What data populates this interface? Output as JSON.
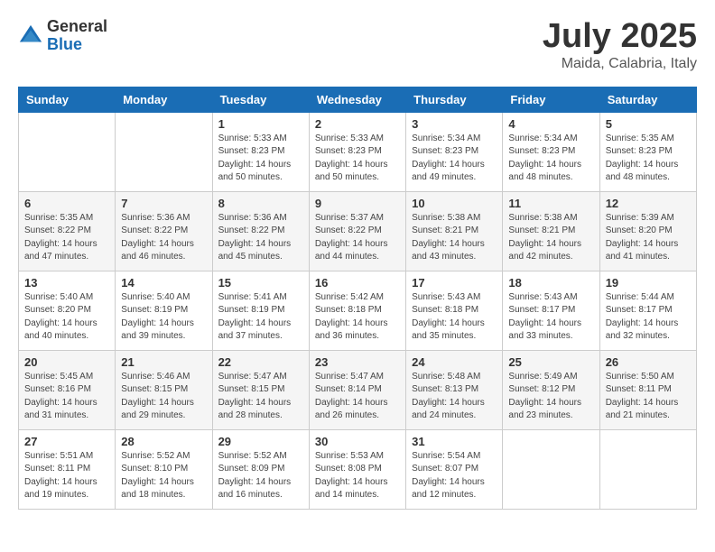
{
  "header": {
    "logo_general": "General",
    "logo_blue": "Blue",
    "month": "July 2025",
    "location": "Maida, Calabria, Italy"
  },
  "weekdays": [
    "Sunday",
    "Monday",
    "Tuesday",
    "Wednesday",
    "Thursday",
    "Friday",
    "Saturday"
  ],
  "weeks": [
    [
      {
        "day": "",
        "sunrise": "",
        "sunset": "",
        "daylight": ""
      },
      {
        "day": "",
        "sunrise": "",
        "sunset": "",
        "daylight": ""
      },
      {
        "day": "1",
        "sunrise": "5:33 AM",
        "sunset": "8:23 PM",
        "daylight": "14 hours and 50 minutes."
      },
      {
        "day": "2",
        "sunrise": "5:33 AM",
        "sunset": "8:23 PM",
        "daylight": "14 hours and 50 minutes."
      },
      {
        "day": "3",
        "sunrise": "5:34 AM",
        "sunset": "8:23 PM",
        "daylight": "14 hours and 49 minutes."
      },
      {
        "day": "4",
        "sunrise": "5:34 AM",
        "sunset": "8:23 PM",
        "daylight": "14 hours and 48 minutes."
      },
      {
        "day": "5",
        "sunrise": "5:35 AM",
        "sunset": "8:23 PM",
        "daylight": "14 hours and 48 minutes."
      }
    ],
    [
      {
        "day": "6",
        "sunrise": "5:35 AM",
        "sunset": "8:22 PM",
        "daylight": "14 hours and 47 minutes."
      },
      {
        "day": "7",
        "sunrise": "5:36 AM",
        "sunset": "8:22 PM",
        "daylight": "14 hours and 46 minutes."
      },
      {
        "day": "8",
        "sunrise": "5:36 AM",
        "sunset": "8:22 PM",
        "daylight": "14 hours and 45 minutes."
      },
      {
        "day": "9",
        "sunrise": "5:37 AM",
        "sunset": "8:22 PM",
        "daylight": "14 hours and 44 minutes."
      },
      {
        "day": "10",
        "sunrise": "5:38 AM",
        "sunset": "8:21 PM",
        "daylight": "14 hours and 43 minutes."
      },
      {
        "day": "11",
        "sunrise": "5:38 AM",
        "sunset": "8:21 PM",
        "daylight": "14 hours and 42 minutes."
      },
      {
        "day": "12",
        "sunrise": "5:39 AM",
        "sunset": "8:20 PM",
        "daylight": "14 hours and 41 minutes."
      }
    ],
    [
      {
        "day": "13",
        "sunrise": "5:40 AM",
        "sunset": "8:20 PM",
        "daylight": "14 hours and 40 minutes."
      },
      {
        "day": "14",
        "sunrise": "5:40 AM",
        "sunset": "8:19 PM",
        "daylight": "14 hours and 39 minutes."
      },
      {
        "day": "15",
        "sunrise": "5:41 AM",
        "sunset": "8:19 PM",
        "daylight": "14 hours and 37 minutes."
      },
      {
        "day": "16",
        "sunrise": "5:42 AM",
        "sunset": "8:18 PM",
        "daylight": "14 hours and 36 minutes."
      },
      {
        "day": "17",
        "sunrise": "5:43 AM",
        "sunset": "8:18 PM",
        "daylight": "14 hours and 35 minutes."
      },
      {
        "day": "18",
        "sunrise": "5:43 AM",
        "sunset": "8:17 PM",
        "daylight": "14 hours and 33 minutes."
      },
      {
        "day": "19",
        "sunrise": "5:44 AM",
        "sunset": "8:17 PM",
        "daylight": "14 hours and 32 minutes."
      }
    ],
    [
      {
        "day": "20",
        "sunrise": "5:45 AM",
        "sunset": "8:16 PM",
        "daylight": "14 hours and 31 minutes."
      },
      {
        "day": "21",
        "sunrise": "5:46 AM",
        "sunset": "8:15 PM",
        "daylight": "14 hours and 29 minutes."
      },
      {
        "day": "22",
        "sunrise": "5:47 AM",
        "sunset": "8:15 PM",
        "daylight": "14 hours and 28 minutes."
      },
      {
        "day": "23",
        "sunrise": "5:47 AM",
        "sunset": "8:14 PM",
        "daylight": "14 hours and 26 minutes."
      },
      {
        "day": "24",
        "sunrise": "5:48 AM",
        "sunset": "8:13 PM",
        "daylight": "14 hours and 24 minutes."
      },
      {
        "day": "25",
        "sunrise": "5:49 AM",
        "sunset": "8:12 PM",
        "daylight": "14 hours and 23 minutes."
      },
      {
        "day": "26",
        "sunrise": "5:50 AM",
        "sunset": "8:11 PM",
        "daylight": "14 hours and 21 minutes."
      }
    ],
    [
      {
        "day": "27",
        "sunrise": "5:51 AM",
        "sunset": "8:11 PM",
        "daylight": "14 hours and 19 minutes."
      },
      {
        "day": "28",
        "sunrise": "5:52 AM",
        "sunset": "8:10 PM",
        "daylight": "14 hours and 18 minutes."
      },
      {
        "day": "29",
        "sunrise": "5:52 AM",
        "sunset": "8:09 PM",
        "daylight": "14 hours and 16 minutes."
      },
      {
        "day": "30",
        "sunrise": "5:53 AM",
        "sunset": "8:08 PM",
        "daylight": "14 hours and 14 minutes."
      },
      {
        "day": "31",
        "sunrise": "5:54 AM",
        "sunset": "8:07 PM",
        "daylight": "14 hours and 12 minutes."
      },
      {
        "day": "",
        "sunrise": "",
        "sunset": "",
        "daylight": ""
      },
      {
        "day": "",
        "sunrise": "",
        "sunset": "",
        "daylight": ""
      }
    ]
  ]
}
